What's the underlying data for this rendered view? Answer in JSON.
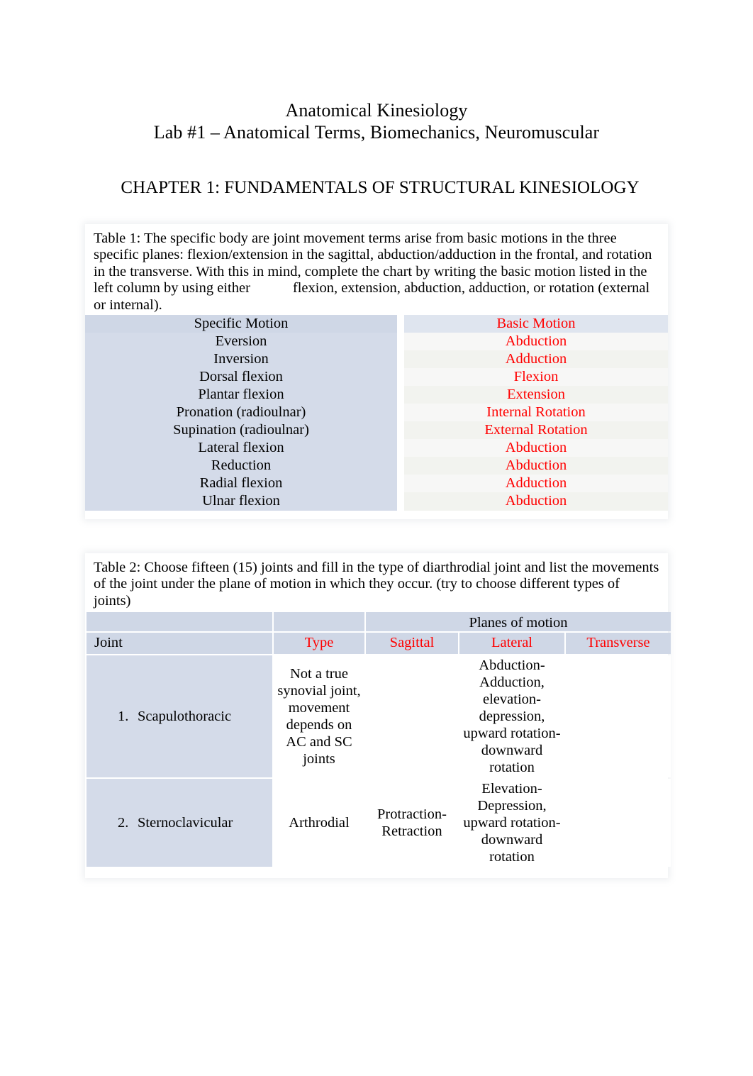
{
  "document": {
    "title_line1": "Anatomical Kinesiology",
    "title_line2": "Lab #1 – Anatomical Terms, Biomechanics, Neuromuscular",
    "chapter_heading": "CHAPTER 1: FUNDAMENTALS OF STRUCTURAL KINESIOLOGY"
  },
  "colors": {
    "red_accent": "#ff0000",
    "cell_blue": "#d4dbe9",
    "header_blue": "#cfd7e6",
    "text": "#000000"
  },
  "table1": {
    "caption_part1": "Table 1:   The specific body are joint movement terms arise from basic motions in the three specific planes: flexion/extension in the sagittal, abduction/adduction in the frontal, and rotation in the transverse. With this in mind, complete the chart by writing the basic motion listed in the left column by using either",
    "caption_part2": "flexion, extension, abduction, adduction, or rotation (external or internal).",
    "headers": {
      "left": "Specific Motion",
      "right": "Basic Motion"
    },
    "rows": [
      {
        "specific_motion": "Eversion",
        "basic_motion": "Abduction"
      },
      {
        "specific_motion": "Inversion",
        "basic_motion": "Adduction"
      },
      {
        "specific_motion": "Dorsal flexion",
        "basic_motion": "Flexion"
      },
      {
        "specific_motion": "Plantar flexion",
        "basic_motion": "Extension"
      },
      {
        "specific_motion": "Pronation (radioulnar)",
        "basic_motion": "Internal Rotation"
      },
      {
        "specific_motion": "Supination (radioulnar)",
        "basic_motion": "External Rotation"
      },
      {
        "specific_motion": "Lateral flexion",
        "basic_motion": "Abduction"
      },
      {
        "specific_motion": "Reduction",
        "basic_motion": "Abduction"
      },
      {
        "specific_motion": "Radial flexion",
        "basic_motion": "Adduction"
      },
      {
        "specific_motion": "Ulnar flexion",
        "basic_motion": "Abduction"
      }
    ]
  },
  "table2": {
    "caption": "Table 2:   Choose fifteen (15) joints and fill in the type of diarthrodial joint and list the movements of the joint under the plane of motion in which they occur. (try to choose different types of joints)",
    "group_header": "Planes of motion",
    "headers": {
      "joint": "Joint",
      "type": "Type",
      "sagittal": "Sagittal",
      "lateral": "Lateral",
      "transverse": "Transverse"
    },
    "rows": [
      {
        "number": "1.",
        "joint": "Scapulothoracic",
        "type": "Not a true synovial joint, movement depends on AC and SC joints",
        "sagittal": "",
        "lateral": "Abduction-Adduction, elevation-depression, upward rotation-downward rotation",
        "transverse": ""
      },
      {
        "number": "2.",
        "joint": "Sternoclavicular",
        "type": "Arthrodial",
        "sagittal": "Protraction-Retraction",
        "lateral": "Elevation-Depression, upward rotation-downward rotation",
        "transverse": ""
      }
    ]
  }
}
